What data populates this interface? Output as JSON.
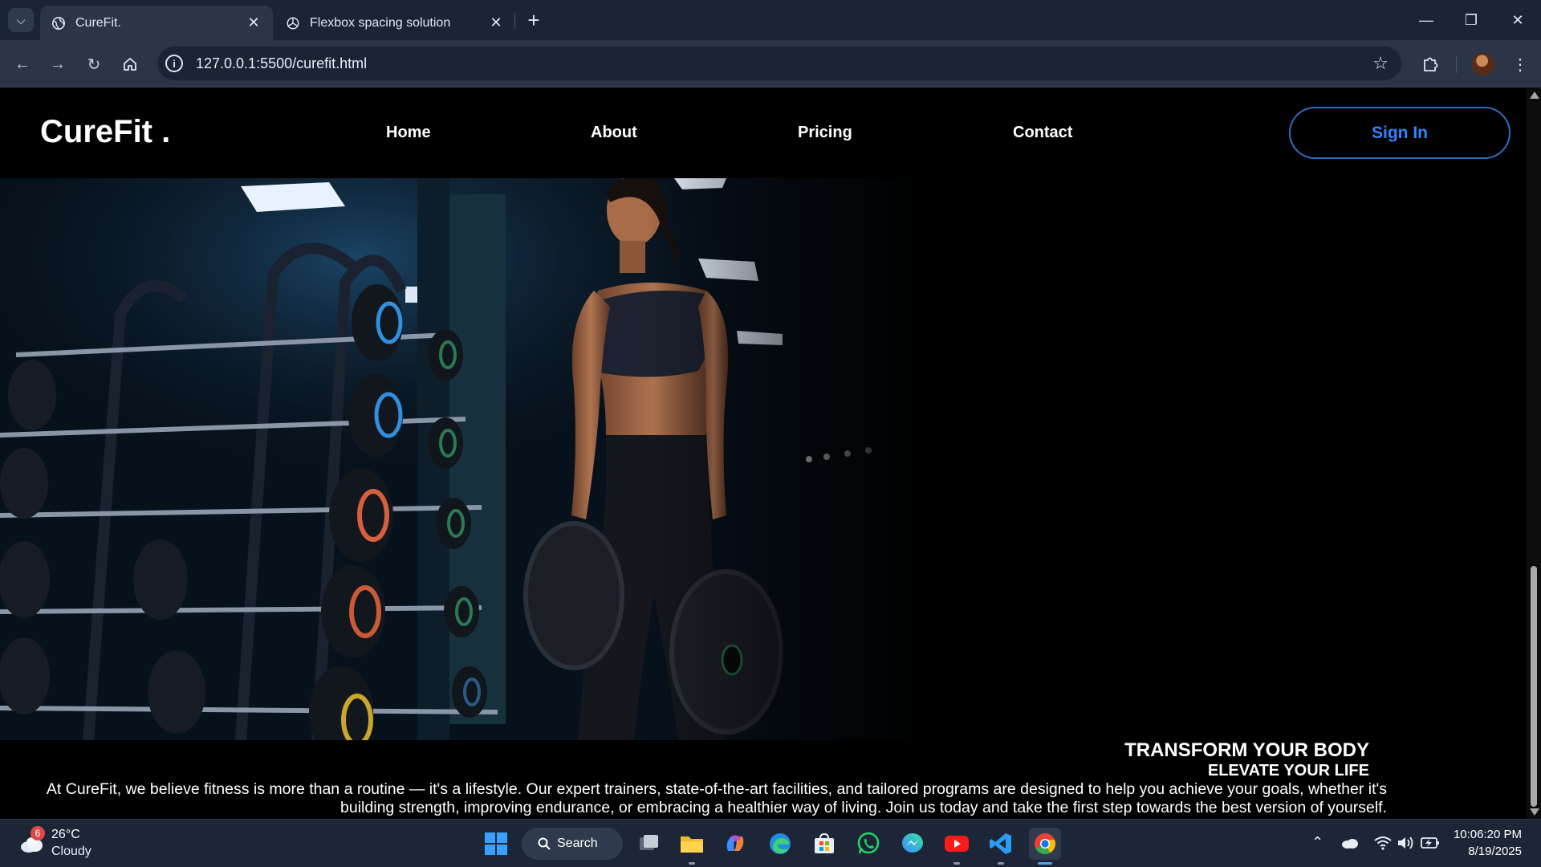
{
  "browser": {
    "tabs": [
      {
        "title": "CureFit.",
        "active": true
      },
      {
        "title": "Flexbox spacing solution",
        "active": false
      }
    ],
    "new_tab": "+",
    "url": "127.0.0.1:5500/curefit.html"
  },
  "site": {
    "logo": "CureFit .",
    "nav": [
      {
        "label": "Home"
      },
      {
        "label": "About"
      },
      {
        "label": "Pricing"
      },
      {
        "label": "Contact"
      }
    ],
    "signin_label": "Sign In",
    "accent_color": "#2e86ff",
    "hero": {
      "heading": "TRANSFORM YOUR BODY",
      "subheading": "ELEVATE YOUR LIFE",
      "paragraph_line1": "At CureFit, we believe fitness is more than a routine — it's a lifestyle. Our expert trainers, state-of-the-art facilities, and tailored programs are designed to help you achieve your goals, whether it's",
      "paragraph_line2": "building strength, improving endurance, or embracing a healthier way of living. Join us today and take the first step towards the best version of yourself."
    }
  },
  "taskbar": {
    "weather": {
      "badge": "6",
      "temp": "26°C",
      "condition": "Cloudy"
    },
    "search_label": "Search",
    "apps": [
      "windows-start",
      "task-view",
      "file-explorer",
      "copilot",
      "edge",
      "microsoft-store",
      "whatsapp",
      "messenger",
      "youtube",
      "vscode",
      "chrome"
    ],
    "clock": {
      "time": "10:06:20 PM",
      "date": "8/19/2025"
    }
  }
}
